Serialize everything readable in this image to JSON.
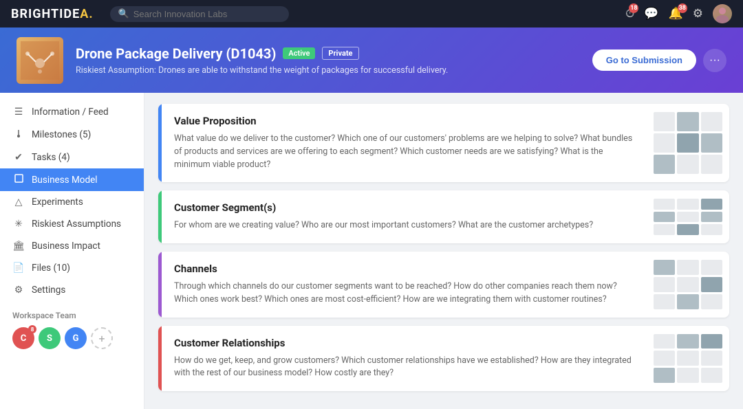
{
  "app": {
    "name": "BRIGHTIDEA",
    "logo_char": "."
  },
  "nav": {
    "search_placeholder": "Search Innovation Labs",
    "badge_timer": "18",
    "badge_chat": "",
    "badge_bell": "38",
    "badge_avatar_c": "8"
  },
  "header": {
    "title": "Drone Package Delivery (D1043)",
    "badge_active": "Active",
    "badge_private": "Private",
    "subtitle": "Riskiest Assumption: Drones are able to withstand the weight of packages for successful delivery.",
    "btn_submission": "Go to Submission",
    "btn_more": "···"
  },
  "sidebar": {
    "items": [
      {
        "id": "information-feed",
        "label": "Information / Feed",
        "icon": "☰"
      },
      {
        "id": "milestones",
        "label": "Milestones (5)",
        "icon": "📍"
      },
      {
        "id": "tasks",
        "label": "Tasks (4)",
        "icon": "✔"
      },
      {
        "id": "business-model",
        "label": "Business Model",
        "icon": "⬜",
        "active": true
      },
      {
        "id": "experiments",
        "label": "Experiments",
        "icon": "△"
      },
      {
        "id": "riskiest-assumptions",
        "label": "Riskiest Assumptions",
        "icon": "✳"
      },
      {
        "id": "business-impact",
        "label": "Business Impact",
        "icon": "🏛"
      },
      {
        "id": "files",
        "label": "Files (10)",
        "icon": "📄"
      },
      {
        "id": "settings",
        "label": "Settings",
        "icon": "⚙"
      }
    ],
    "workspace_label": "Workspace Team",
    "workspace_members": [
      {
        "initial": "C",
        "color": "#e05252",
        "badge": "8"
      },
      {
        "initial": "S",
        "color": "#3ec97a"
      },
      {
        "initial": "G",
        "color": "#4285f4"
      }
    ]
  },
  "canvas_cards": [
    {
      "id": "value-proposition",
      "title": "Value Proposition",
      "stripe_color": "#4285f4",
      "description": "What value do we deliver to the customer? Which one of our customers' problems are we helping to solve? What bundles of products and services are we offering to each segment? Which customer needs are we satisfying? What is the minimum viable product?"
    },
    {
      "id": "customer-segments",
      "title": "Customer Segment(s)",
      "stripe_color": "#3ec97a",
      "description": "For whom are we creating value? Who are our most important customers? What are the customer archetypes?"
    },
    {
      "id": "channels",
      "title": "Channels",
      "stripe_color": "#9c59d1",
      "description": "Through which channels do our customer segments want to be reached? How do other companies reach them now? Which ones work best? Which ones are most cost-efficient? How are we integrating them with customer routines?"
    },
    {
      "id": "customer-relationships",
      "title": "Customer Relationships",
      "stripe_color": "#e05252",
      "description": "How do we get, keep, and grow customers? Which customer relationships have we established? How are they integrated with the rest of our business model? How costly are they?"
    }
  ]
}
